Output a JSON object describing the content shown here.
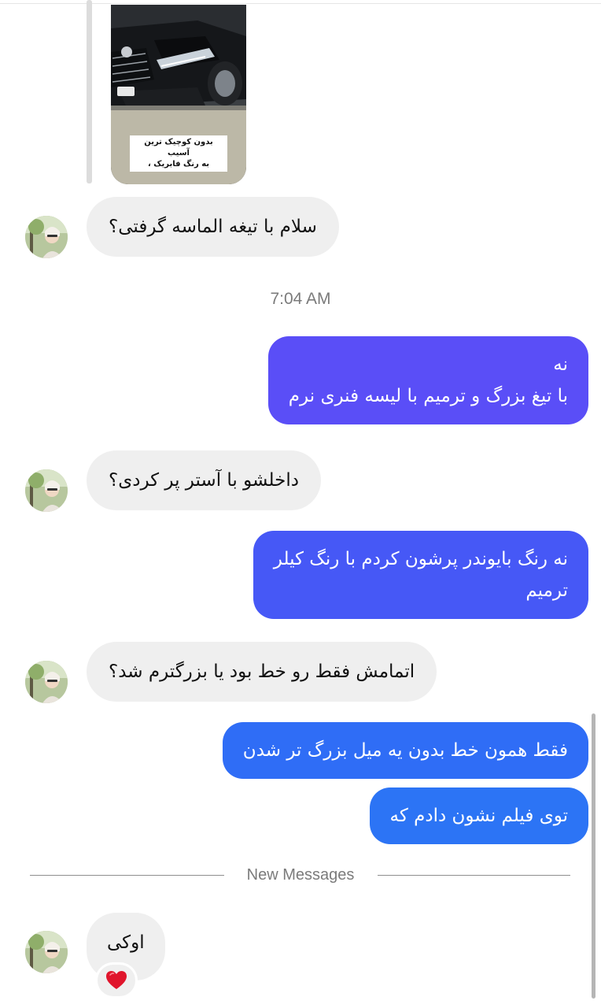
{
  "shared_post": {
    "caption_line1": "بدون کوچیک ترین آسیب",
    "caption_line2": "به رنگ فابریک ،"
  },
  "messages": [
    {
      "sender": "them",
      "text": "سلام با تیغه الماسه گرفتی؟"
    },
    {
      "sender": "me",
      "line1": "نه",
      "line2": "با تیغ بزرگ و ترمیم با لیسه  فنری نرم"
    },
    {
      "sender": "them",
      "text": "داخلشو با آستر پر کردی؟"
    },
    {
      "sender": "me",
      "line1": "نه  رنگ بایوندر پرشون کردم با رنگ کیلر",
      "line2": "ترمیم"
    },
    {
      "sender": "them",
      "text": "اتمامش فقط رو خط بود یا بزرگترم شد؟"
    },
    {
      "sender": "me",
      "text": "فقط همون خط بدون یه میل بزرگ تر شدن"
    },
    {
      "sender": "me",
      "text": "توی فیلم نشون دادم که"
    },
    {
      "sender": "them",
      "text": "اوکی",
      "reaction": "heart"
    }
  ],
  "timestamp": "7:04 AM",
  "divider": {
    "label": "New Messages"
  },
  "colors": {
    "incoming_bubble": "#efefef",
    "outgoing_purple": "#5a4ef7",
    "outgoing_blue_mid": "#4658f6",
    "outgoing_blue": "#2f6df6",
    "outgoing_blue_light": "#2c74f5",
    "reaction_heart": "#e0152c"
  }
}
